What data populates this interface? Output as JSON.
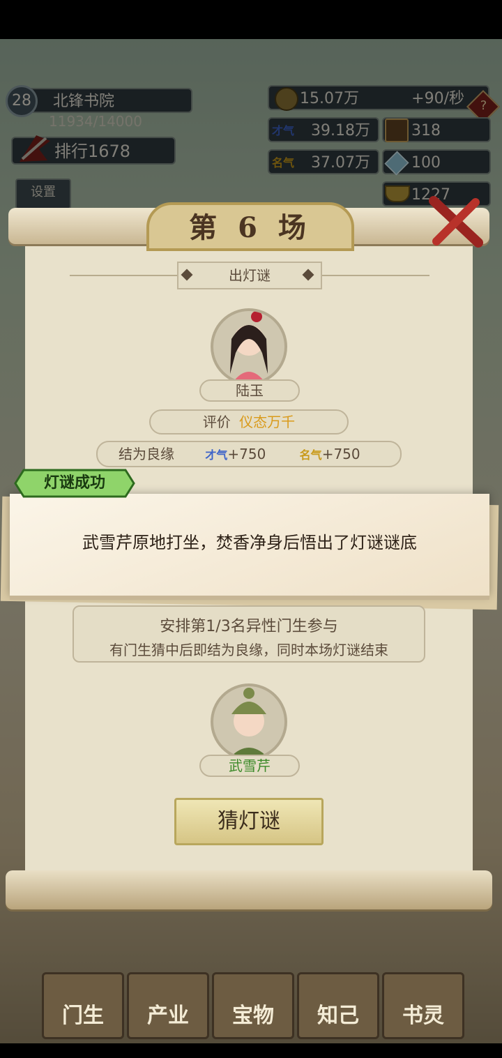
{
  "hud": {
    "level": "28",
    "academy_name": "北锋书院",
    "exp": "11934/14000",
    "rank_label": "排行1678",
    "coins": "15.07万",
    "coin_rate": "+90/秒",
    "talent_tag": "才气",
    "talent": "39.18万",
    "fame_tag": "名气",
    "fame": "37.07万",
    "box_count": "318",
    "gem_count": "100",
    "ingot_count": "1227",
    "settings_label": "设置"
  },
  "dialog": {
    "title": "第 6 场",
    "section_label": "出灯谜",
    "poser_name": "陆玉",
    "rating_label": "评价",
    "rating_value": "仪态万千",
    "reward_label": "结为良缘",
    "reward_talent_tag": "才气",
    "reward_talent": "+750",
    "reward_fame_tag": "名气",
    "reward_fame": "+750",
    "arrange_line1": "安排第1/3名异性门生参与",
    "arrange_line2": "有门生猜中后即结为良缘，同时本场灯谜结束",
    "student_name": "武雪芹",
    "guess_button": "猜灯谜"
  },
  "toast": {
    "tag": "灯谜成功",
    "message": "武雪芹原地打坐，焚香净身后悟出了灯谜谜底"
  },
  "nav": {
    "items": [
      "门生",
      "产业",
      "宝物",
      "知己",
      "书灵"
    ]
  },
  "colors": {
    "rating_value": "#d99a1a",
    "student_name": "#3d8a2a",
    "toast_tag_bg": "#8fd46a"
  }
}
